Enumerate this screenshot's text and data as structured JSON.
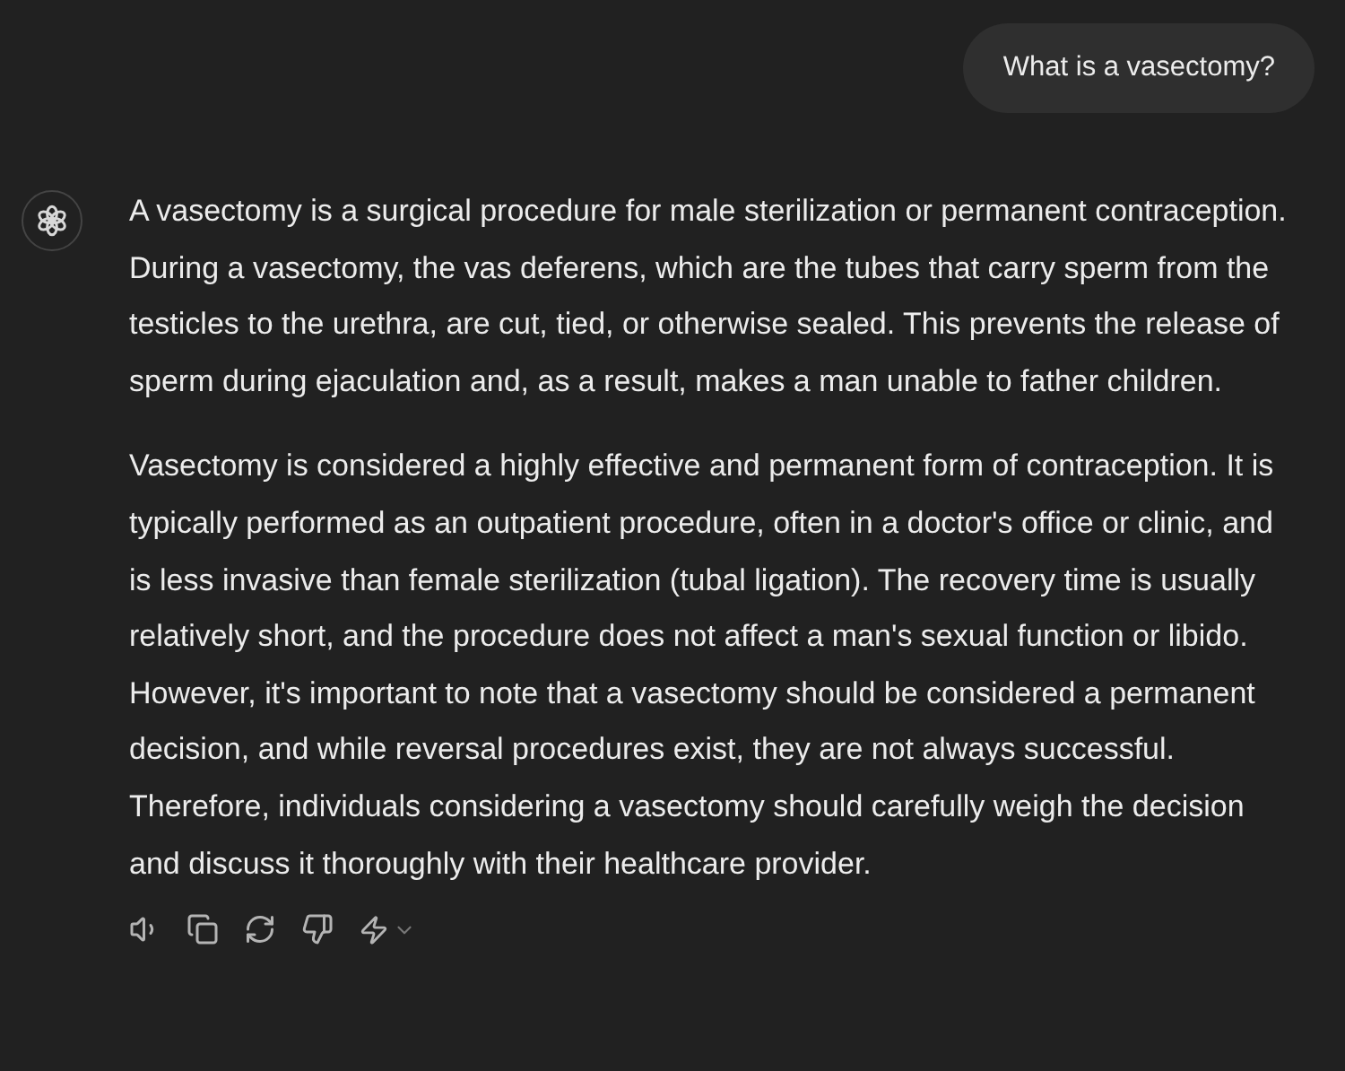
{
  "user_message": {
    "text": "What is a vasectomy?"
  },
  "assistant_message": {
    "paragraphs": [
      "A vasectomy is a surgical procedure for male sterilization or permanent contraception. During a vasectomy, the vas deferens, which are the tubes that carry sperm from the testicles to the urethra, are cut, tied, or otherwise sealed. This prevents the release of sperm during ejaculation and, as a result, makes a man unable to father children.",
      "Vasectomy is considered a highly effective and permanent form of contraception. It is typically performed as an outpatient procedure, often in a doctor's office or clinic, and is less invasive than female sterilization (tubal ligation). The recovery time is usually relatively short, and the procedure does not affect a man's sexual function or libido. However, it's important to note that a vasectomy should be considered a permanent decision, and while reversal procedures exist, they are not always successful. Therefore, individuals considering a vasectomy should carefully weigh the decision and discuss it thoroughly with their healthcare provider."
    ],
    "actions": [
      {
        "kind": "read-aloud"
      },
      {
        "kind": "copy"
      },
      {
        "kind": "regenerate"
      },
      {
        "kind": "dislike"
      },
      {
        "kind": "model-switch"
      }
    ]
  }
}
